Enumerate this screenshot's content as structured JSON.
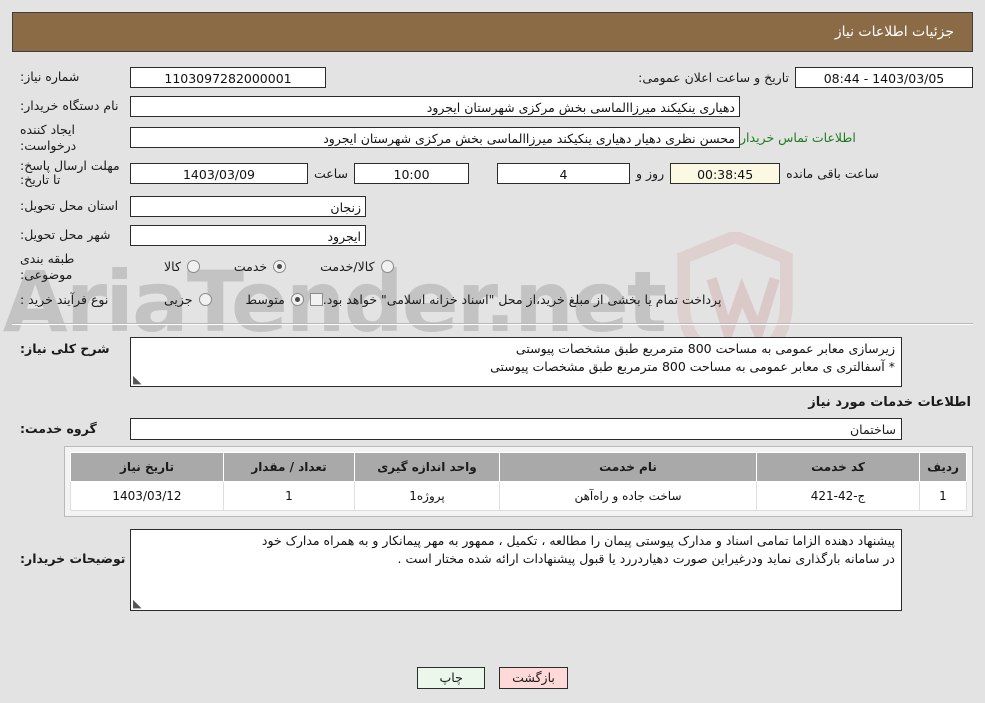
{
  "header": {
    "title": "جزئیات اطلاعات نیاز"
  },
  "form": {
    "need_number_label": "شماره نیاز:",
    "need_number_value": "1103097282000001",
    "announce_datetime_label": "تاریخ و ساعت اعلان عمومی:",
    "announce_datetime_value": "1403/03/05 - 08:44",
    "buyer_org_label": "نام دستگاه خریدار:",
    "buyer_org_value": "دهیاری ینکیکند میرزاالماسی بخش مرکزی شهرستان ایجرود",
    "requester_label": "ایجاد کننده درخواست:",
    "requester_value": "محسن نظری دهیار دهیاری ینکیکند میرزاالماسی بخش مرکزی شهرستان ایجرود",
    "buyer_contact_link": "اطلاعات تماس خریدار",
    "deadline_label": "مهلت ارسال پاسخ: تا تاریخ:",
    "deadline_date": "1403/03/09",
    "deadline_hour_label": "ساعت",
    "deadline_hour": "10:00",
    "days_remaining": "4",
    "days_label": "روز و",
    "countdown": "00:38:45",
    "countdown_label": "ساعت باقی مانده",
    "province_label": "استان محل تحویل:",
    "province_value": "زنجان",
    "city_label": "شهر محل تحویل:",
    "city_value": "ایجرود",
    "category_label": "طبقه بندی موضوعی:",
    "category_options": [
      {
        "label": "کالا",
        "selected": false
      },
      {
        "label": "خدمت",
        "selected": true
      },
      {
        "label": "کالا/خدمت",
        "selected": false
      }
    ],
    "process_label": "نوع فرآیند خرید :",
    "process_options": [
      {
        "label": "جزیی",
        "selected": false
      },
      {
        "label": "متوسط",
        "selected": true
      }
    ],
    "treasury_checkbox_checked": false,
    "treasury_note": "پرداخت تمام یا بخشی از مبلغ خرید،از محل \"اسناد خزانه اسلامی\" خواهد بود."
  },
  "description": {
    "label": "شرح کلی نیاز:",
    "line1": "زیرسازی معابر عمومی به مساحت 800 مترمربع طبق مشخصات پیوستی",
    "line2": "* آسفالتری ی معابر عمومی به مساحت 800 مترمربع طبق مشخصات پیوستی"
  },
  "services_section": {
    "heading": "اطلاعات خدمات مورد نیاز",
    "group_label": "گروه خدمت:",
    "group_value": "ساختمان"
  },
  "table": {
    "columns": [
      "ردیف",
      "کد خدمت",
      "نام خدمت",
      "واحد اندازه گیری",
      "تعداد / مقدار",
      "تاریخ نیاز"
    ],
    "rows": [
      {
        "row_no": "1",
        "service_code": "ج-42-421",
        "service_name": "ساخت جاده و راه‌آهن",
        "unit": "پروژه1",
        "quantity": "1",
        "need_date": "1403/03/12"
      }
    ]
  },
  "buyer_notes": {
    "label": "توضیحات خریدار:",
    "line1": "پیشنهاد دهنده الزاما تمامی اسناد و مدارک پیوستی پیمان را مطالعه ، تکمیل ، ممهور به مهر پیمانکار و به همراه مدارک خود",
    "line2": "در سامانه بارگذاری نماید ودرغیراین صورت دهیاردررد یا قبول پیشنهادات ارائه شده مختار است ."
  },
  "footer": {
    "print_label": "چاپ",
    "back_label": "بازگشت"
  },
  "watermark": {
    "text": "AriaTender.net"
  },
  "colors": {
    "header_bg": "#8b6b45",
    "page_bg": "#e3e3e3",
    "link_green": "#1f7a1f",
    "countdown_bg": "#fbf9e4",
    "print_btn_bg": "#eaf7ea",
    "back_btn_bg": "#ffd8d8",
    "table_header_bg": "#a9a9a9"
  }
}
